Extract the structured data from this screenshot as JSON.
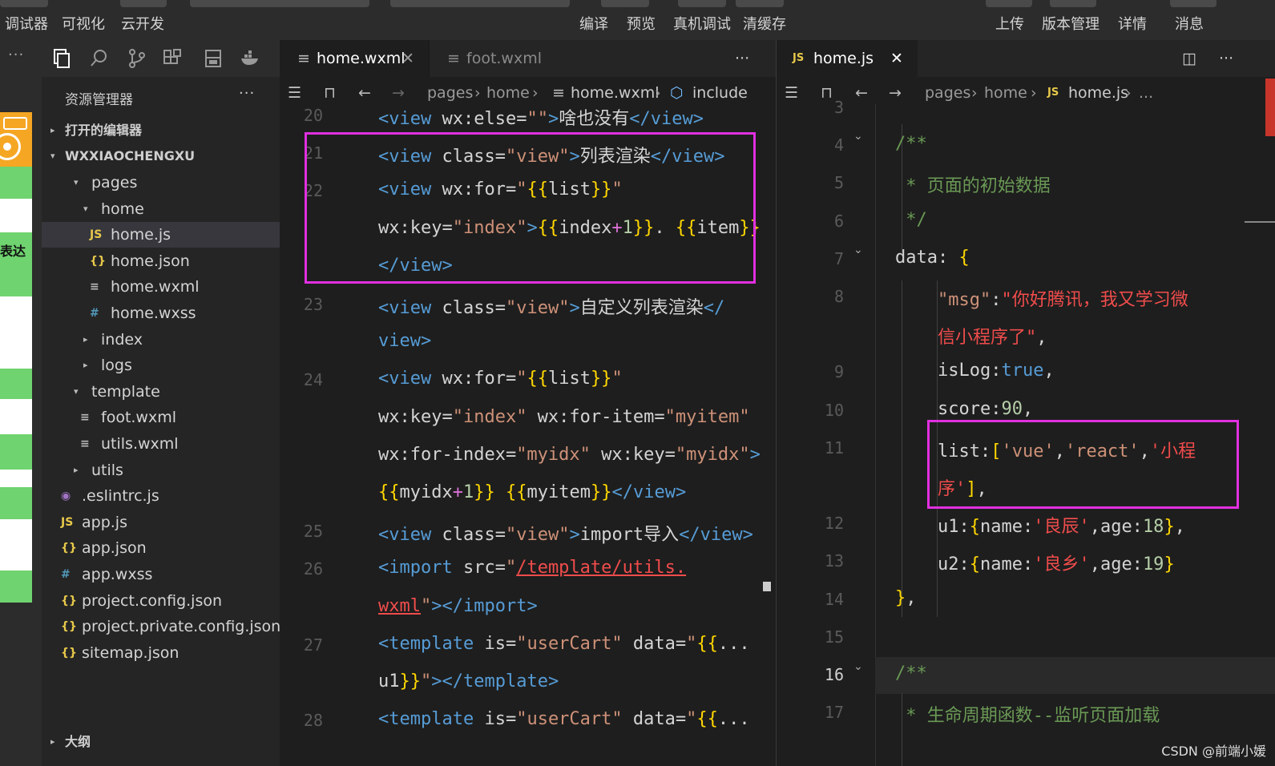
{
  "toolbar": {
    "items": [
      "调试器",
      "可视化",
      "云开发",
      "编译",
      "预览",
      "真机调试",
      "清缓存",
      "上传",
      "版本管理",
      "详情",
      "消息"
    ]
  },
  "activity": {
    "more": "···",
    "green_label": "表达"
  },
  "explorer": {
    "title": "资源管理器",
    "more": "···",
    "open_editors": "打开的编辑器",
    "project": "WXXIAOCHENGXU",
    "outline": "大纲",
    "tree": [
      {
        "label": "pages",
        "icon": "",
        "arrow": "▾"
      },
      {
        "label": "home",
        "icon": "",
        "arrow": "▾"
      },
      {
        "label": "home.js",
        "icon": "JS",
        "arrow": ""
      },
      {
        "label": "home.json",
        "icon": "{}",
        "arrow": ""
      },
      {
        "label": "home.wxml",
        "icon": "≡",
        "arrow": ""
      },
      {
        "label": "home.wxss",
        "icon": "#",
        "arrow": ""
      },
      {
        "label": "index",
        "icon": "",
        "arrow": "▸"
      },
      {
        "label": "logs",
        "icon": "",
        "arrow": "▸"
      },
      {
        "label": "template",
        "icon": "",
        "arrow": "▾"
      },
      {
        "label": "foot.wxml",
        "icon": "≡",
        "arrow": ""
      },
      {
        "label": "utils.wxml",
        "icon": "≡",
        "arrow": ""
      },
      {
        "label": "utils",
        "icon": "",
        "arrow": "▸"
      },
      {
        "label": ".eslintrc.js",
        "icon": "◉",
        "arrow": ""
      },
      {
        "label": "app.js",
        "icon": "JS",
        "arrow": ""
      },
      {
        "label": "app.json",
        "icon": "{}",
        "arrow": ""
      },
      {
        "label": "app.wxss",
        "icon": "#",
        "arrow": ""
      },
      {
        "label": "project.config.json",
        "icon": "{}",
        "arrow": ""
      },
      {
        "label": "project.private.config.json",
        "icon": "{}",
        "arrow": ""
      },
      {
        "label": "sitemap.json",
        "icon": "{}",
        "arrow": ""
      }
    ]
  },
  "editor1": {
    "tabs": [
      "home.wxml",
      "foot.wxml"
    ],
    "more": "···",
    "breadcrumb": [
      "pages",
      "home",
      "home.wxml",
      "include"
    ],
    "lines": [
      {
        "n": "20",
        "parts": [
          [
            "kw",
            "<view "
          ],
          [
            "at",
            "wx:else="
          ],
          [
            "st",
            "\"\""
          ],
          [
            "kw",
            ">"
          ],
          [
            "at",
            "啥也没有"
          ],
          [
            "kw",
            "</view>"
          ]
        ]
      },
      {
        "n": "21",
        "parts": [
          [
            "kw",
            "<view "
          ],
          [
            "at",
            "class="
          ],
          [
            "st",
            "\"view\""
          ],
          [
            "kw",
            ">"
          ],
          [
            "at",
            "列表渲染"
          ],
          [
            "kw",
            "</view>"
          ]
        ]
      },
      {
        "n": "22",
        "parts": [
          [
            "kw",
            "<view "
          ],
          [
            "at",
            "wx:for="
          ],
          [
            "st",
            "\""
          ],
          [
            "br",
            "{{"
          ],
          [
            "at",
            "list"
          ],
          [
            "br",
            "}}"
          ],
          [
            "st",
            "\""
          ]
        ]
      },
      {
        "n": "",
        "parts": [
          [
            "at",
            "wx:key="
          ],
          [
            "st",
            "\"index\""
          ],
          [
            "kw",
            ">"
          ],
          [
            "br",
            "{{"
          ],
          [
            "at",
            "index"
          ],
          [
            "pink",
            "+"
          ],
          [
            "num",
            "1"
          ],
          [
            "br",
            "}}"
          ],
          [
            "at",
            ". "
          ],
          [
            "br",
            "{{"
          ],
          [
            "at",
            "item"
          ],
          [
            "br",
            "}}"
          ]
        ]
      },
      {
        "n": "",
        "parts": [
          [
            "kw",
            "</view>"
          ]
        ]
      },
      {
        "n": "23",
        "parts": [
          [
            "kw",
            "<view "
          ],
          [
            "at",
            "class="
          ],
          [
            "st",
            "\"view\""
          ],
          [
            "kw",
            ">"
          ],
          [
            "at",
            "自定义列表渲染"
          ],
          [
            "kw",
            "</"
          ]
        ]
      },
      {
        "n": "",
        "parts": [
          [
            "kw",
            "view>"
          ]
        ]
      },
      {
        "n": "24",
        "parts": [
          [
            "kw",
            "<view "
          ],
          [
            "at",
            "wx:for="
          ],
          [
            "st",
            "\""
          ],
          [
            "br",
            "{{"
          ],
          [
            "at",
            "list"
          ],
          [
            "br",
            "}}"
          ],
          [
            "st",
            "\""
          ]
        ]
      },
      {
        "n": "",
        "parts": [
          [
            "at",
            "wx:key="
          ],
          [
            "st",
            "\"index\""
          ],
          [
            "at",
            " wx:for-item="
          ],
          [
            "st",
            "\"myitem\""
          ]
        ]
      },
      {
        "n": "",
        "parts": [
          [
            "at",
            "wx:for-index="
          ],
          [
            "st",
            "\"myidx\""
          ],
          [
            "at",
            " wx:key="
          ],
          [
            "st",
            "\"myidx\""
          ],
          [
            "kw",
            ">"
          ]
        ]
      },
      {
        "n": "",
        "parts": [
          [
            "br",
            "{{"
          ],
          [
            "at",
            "myidx"
          ],
          [
            "pink",
            "+"
          ],
          [
            "num",
            "1"
          ],
          [
            "br",
            "}}"
          ],
          [
            "at",
            " "
          ],
          [
            "br",
            "{{"
          ],
          [
            "at",
            "myitem"
          ],
          [
            "br",
            "}}"
          ],
          [
            "kw",
            "</view>"
          ]
        ]
      },
      {
        "n": "25",
        "parts": [
          [
            "kw",
            "<view "
          ],
          [
            "at",
            "class="
          ],
          [
            "st",
            "\"view\""
          ],
          [
            "kw",
            ">"
          ],
          [
            "at",
            "import导入"
          ],
          [
            "kw",
            "</view>"
          ]
        ]
      },
      {
        "n": "26",
        "parts": [
          [
            "kw",
            "<import "
          ],
          [
            "at",
            "src="
          ],
          [
            "st",
            "\""
          ],
          [
            "str2",
            "/template/utils."
          ]
        ]
      },
      {
        "n": "",
        "parts": [
          [
            "str2",
            "wxml"
          ],
          [
            "st",
            "\""
          ],
          [
            "kw",
            "></import>"
          ]
        ]
      },
      {
        "n": "27",
        "parts": [
          [
            "kw",
            "<template "
          ],
          [
            "at",
            "is="
          ],
          [
            "st",
            "\"userCart\""
          ],
          [
            "at",
            " data="
          ],
          [
            "st",
            "\""
          ],
          [
            "br",
            "{{"
          ],
          [
            "at",
            "..."
          ]
        ]
      },
      {
        "n": "",
        "parts": [
          [
            "at",
            "u1"
          ],
          [
            "br",
            "}}"
          ],
          [
            "st",
            "\""
          ],
          [
            "kw",
            "></template>"
          ]
        ]
      },
      {
        "n": "28",
        "parts": [
          [
            "kw",
            "<template "
          ],
          [
            "at",
            "is="
          ],
          [
            "st",
            "\"userCart\""
          ],
          [
            "at",
            " data="
          ],
          [
            "st",
            "\""
          ],
          [
            "br",
            "{{"
          ],
          [
            "at",
            "..."
          ]
        ]
      }
    ]
  },
  "editor2": {
    "tab": "home.js",
    "tab_icon": "JS",
    "more": "···",
    "breadcrumb": [
      "pages",
      "home",
      "home.js",
      "..."
    ],
    "lines": [
      {
        "n": "3",
        "parts": []
      },
      {
        "n": "4",
        "parts": [
          [
            "cm",
            "/**"
          ]
        ]
      },
      {
        "n": "5",
        "parts": [
          [
            "cm",
            " * 页面的初始数据"
          ]
        ]
      },
      {
        "n": "6",
        "parts": [
          [
            "cm",
            " */"
          ]
        ]
      },
      {
        "n": "7",
        "parts": [
          [
            "at",
            "data: "
          ],
          [
            "br",
            "{"
          ]
        ]
      },
      {
        "n": "8",
        "parts": [
          [
            "at",
            "    "
          ],
          [
            "st",
            "\"msg\""
          ],
          [
            "at",
            ":"
          ],
          [
            "str2",
            "\"你好腾讯，我又学习微"
          ]
        ]
      },
      {
        "n": "",
        "parts": [
          [
            "at",
            "    "
          ],
          [
            "str2",
            "信小程序了\""
          ],
          [
            "at",
            ","
          ]
        ]
      },
      {
        "n": "9",
        "parts": [
          [
            "at",
            "    isLog:"
          ],
          [
            "kw",
            "true"
          ],
          [
            "at",
            ","
          ]
        ]
      },
      {
        "n": "10",
        "parts": [
          [
            "at",
            "    score:"
          ],
          [
            "num",
            "90"
          ],
          [
            "at",
            ","
          ]
        ]
      },
      {
        "n": "11",
        "parts": [
          [
            "at",
            "    list:"
          ],
          [
            "br",
            "["
          ],
          [
            "st",
            "'vue'"
          ],
          [
            "at",
            ","
          ],
          [
            "st",
            "'react'"
          ],
          [
            "at",
            ","
          ],
          [
            "str2",
            "'小程"
          ]
        ]
      },
      {
        "n": "",
        "parts": [
          [
            "at",
            "    "
          ],
          [
            "str2",
            "序'"
          ],
          [
            "br",
            "]"
          ],
          [
            "at",
            ","
          ]
        ]
      },
      {
        "n": "12",
        "parts": [
          [
            "at",
            "    u1:"
          ],
          [
            "br",
            "{"
          ],
          [
            "at",
            "name:"
          ],
          [
            "str2",
            "'良辰'"
          ],
          [
            "at",
            ",age:"
          ],
          [
            "num",
            "18"
          ],
          [
            "br",
            "}"
          ],
          [
            "at",
            ","
          ]
        ]
      },
      {
        "n": "13",
        "parts": [
          [
            "at",
            "    u2:"
          ],
          [
            "br",
            "{"
          ],
          [
            "at",
            "name:"
          ],
          [
            "str2",
            "'良乡'"
          ],
          [
            "at",
            ",age:"
          ],
          [
            "num",
            "19"
          ],
          [
            "br",
            "}"
          ]
        ]
      },
      {
        "n": "14",
        "parts": [
          [
            "br",
            "}"
          ],
          [
            "at",
            ","
          ]
        ]
      },
      {
        "n": "15",
        "parts": []
      },
      {
        "n": "16",
        "parts": [
          [
            "cm",
            "/**"
          ]
        ]
      },
      {
        "n": "17",
        "parts": [
          [
            "cm",
            " * 生命周期函数--监听页面加载"
          ]
        ]
      }
    ]
  },
  "watermark": "CSDN @前端小媛"
}
